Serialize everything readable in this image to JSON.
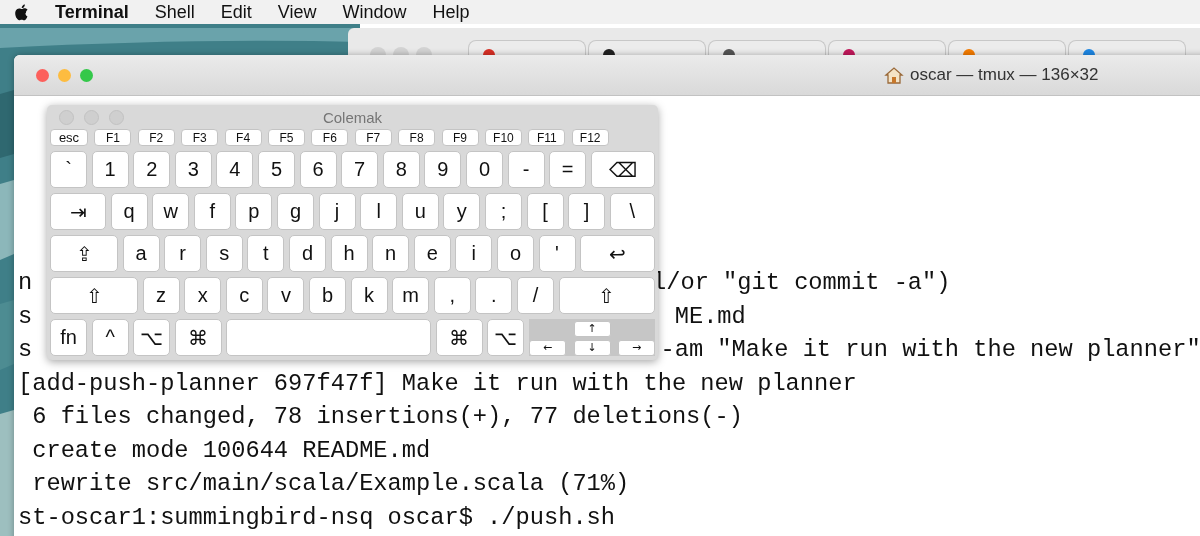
{
  "menu_bar": {
    "items": [
      {
        "label": "Terminal"
      },
      {
        "label": "Shell"
      },
      {
        "label": "Edit"
      },
      {
        "label": "View"
      },
      {
        "label": "Window"
      },
      {
        "label": "Help"
      }
    ]
  },
  "terminal": {
    "title": "oscar — tmux — 136×32",
    "lines": [
      {
        "text": "n",
        "tail": "l/or \"git commit -a\")"
      },
      {
        "text": "s",
        "tail": "ME.md"
      },
      {
        "text": "s",
        "tail": "-am \"Make it run with the new planner\""
      },
      {
        "text": "[add-push-planner 697f47f] Make it run with the new planner"
      },
      {
        "text": " 6 files changed, 78 insertions(+), 77 deletions(-)"
      },
      {
        "text": " create mode 100644 README.md"
      },
      {
        "text": " rewrite src/main/scala/Example.scala (71%)"
      },
      {
        "text": "st-oscar1:summingbird-nsq oscar$ ./push.sh"
      }
    ]
  },
  "keyboard": {
    "title": "Colemak",
    "function_keys": [
      "esc",
      "F1",
      "F2",
      "F3",
      "F4",
      "F5",
      "F6",
      "F7",
      "F8",
      "F9",
      "F10",
      "F11",
      "F12"
    ],
    "rows": [
      [
        "`",
        "1",
        "2",
        "3",
        "4",
        "5",
        "6",
        "7",
        "8",
        "9",
        "0",
        "-",
        "=",
        "⌫"
      ],
      [
        "⇥",
        "q",
        "w",
        "f",
        "p",
        "g",
        "j",
        "l",
        "u",
        "y",
        ";",
        "[",
        "]",
        "\\"
      ],
      [
        "⇪",
        "a",
        "r",
        "s",
        "t",
        "d",
        "h",
        "n",
        "e",
        "i",
        "o",
        "'",
        "↩"
      ],
      [
        "⇧",
        "z",
        "x",
        "c",
        "v",
        "b",
        "k",
        "m",
        ",",
        ".",
        "/",
        "⇧"
      ]
    ],
    "left_modifiers": [
      "fn",
      "^",
      "⌥",
      "⌘"
    ],
    "right_modifiers": [
      "⌘",
      "⌥"
    ],
    "arrows": [
      "↑",
      "←",
      "↓",
      "→"
    ]
  }
}
